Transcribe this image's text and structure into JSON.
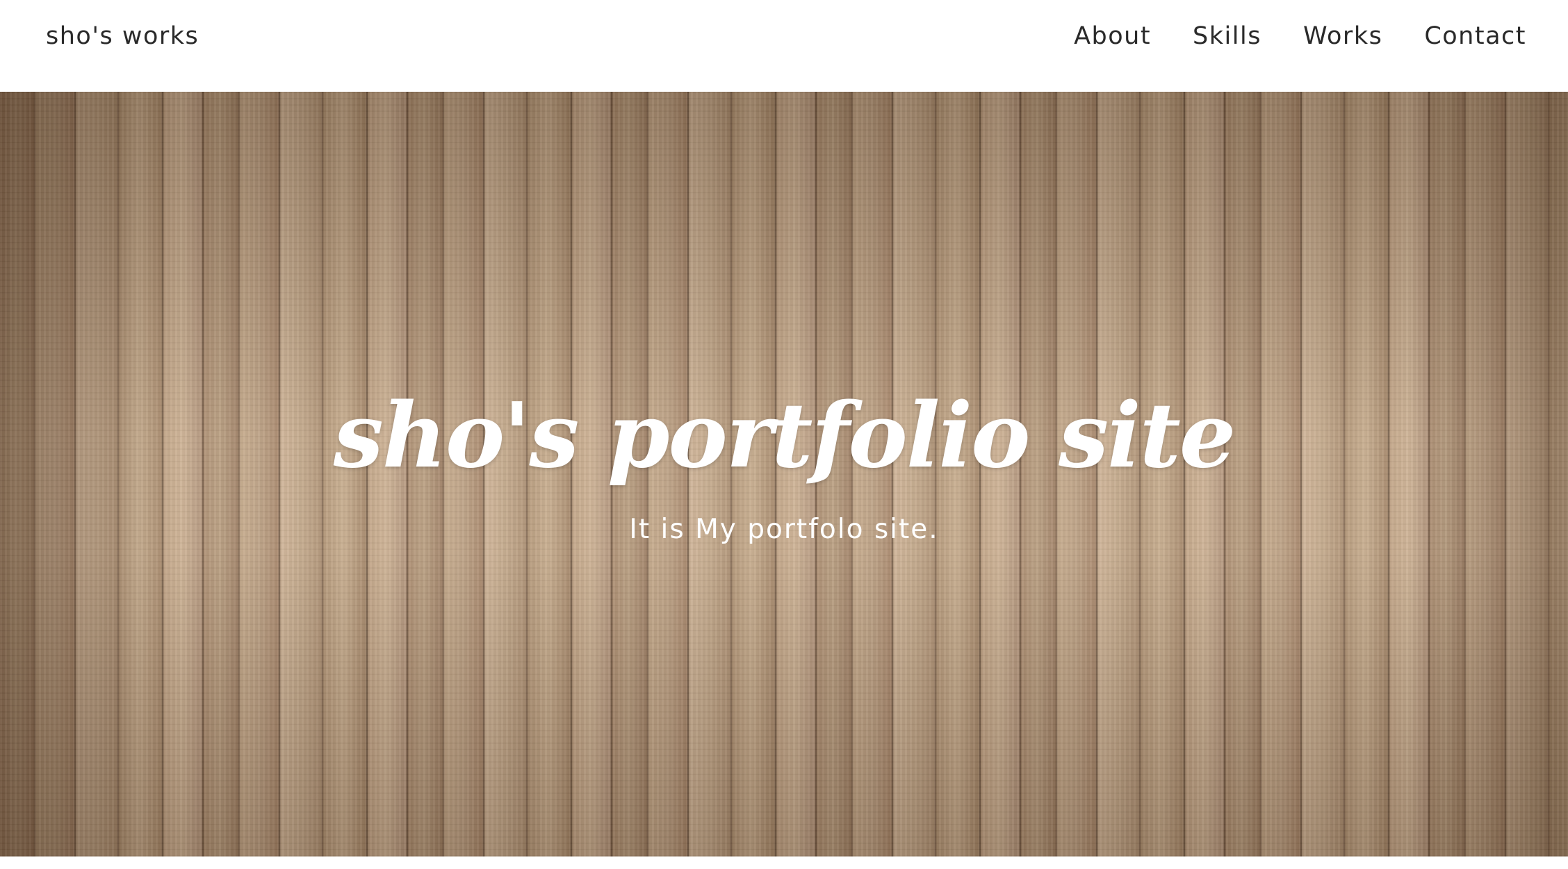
{
  "header": {
    "brand": "sho's works",
    "nav": [
      {
        "label": "About"
      },
      {
        "label": "Skills"
      },
      {
        "label": "Works"
      },
      {
        "label": "Contact"
      }
    ]
  },
  "hero": {
    "title": "sho's portfolio site",
    "subtitle": "It is My portfolo site."
  },
  "colors": {
    "text": "#2a2a2a",
    "header_bg": "#ffffff",
    "hero_text": "#ffffff",
    "hero_wood": "#b79e83"
  }
}
